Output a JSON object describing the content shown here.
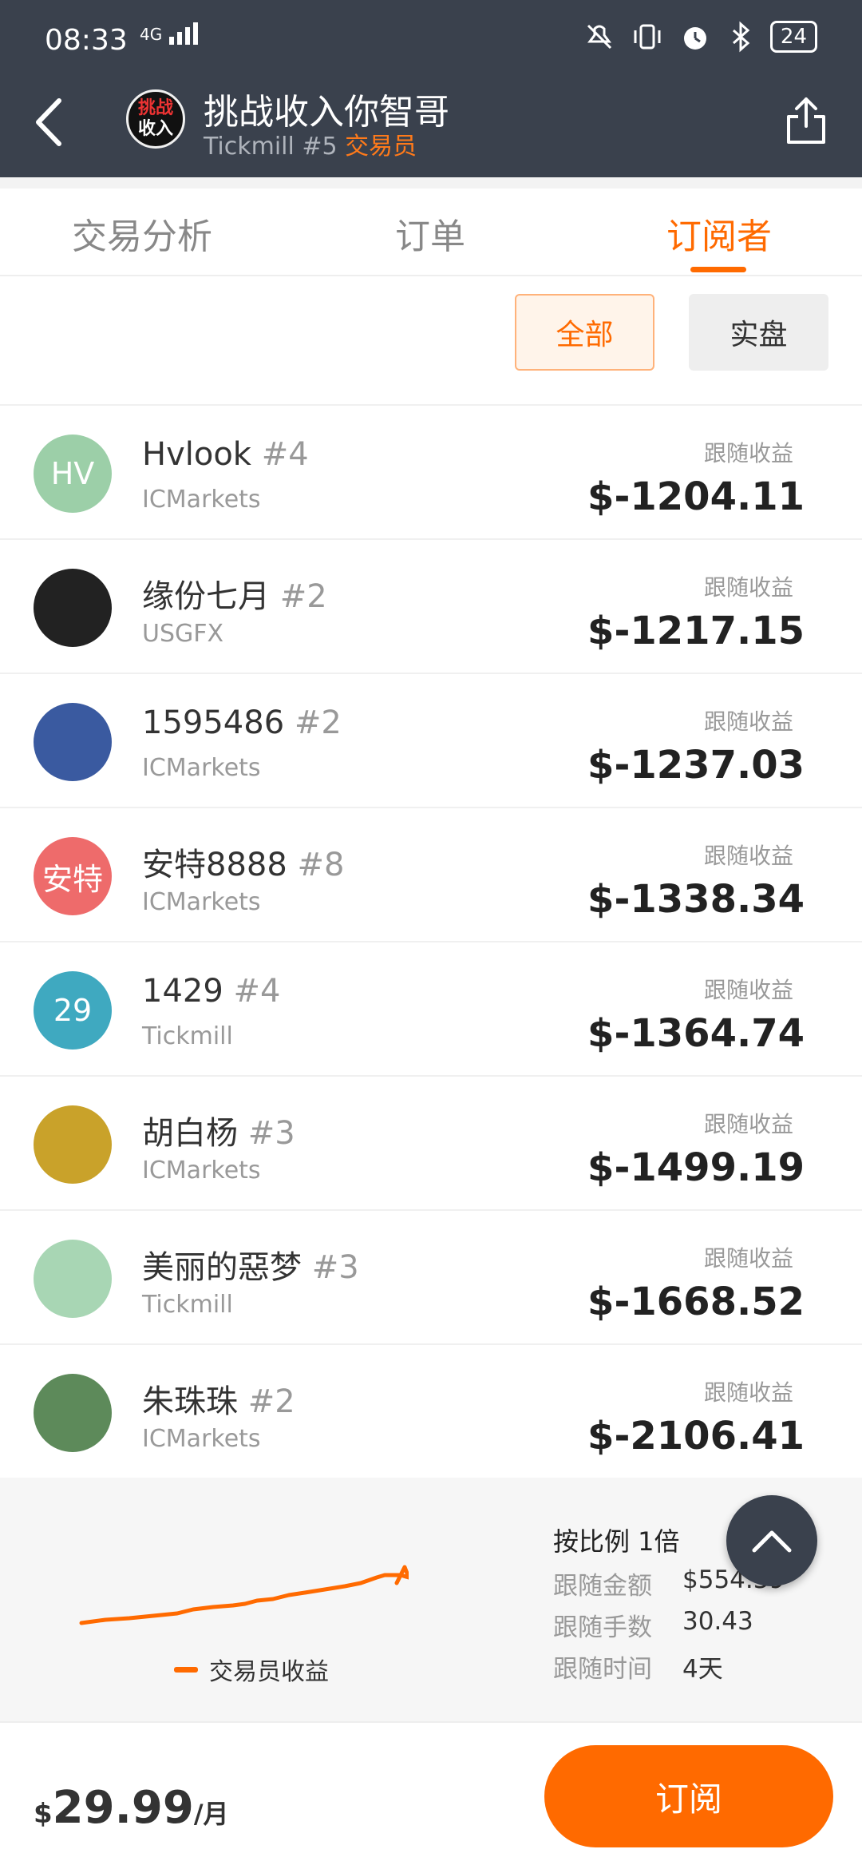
{
  "status_bar": {
    "time": "08:33",
    "network": "4G",
    "battery": "24"
  },
  "header": {
    "avatar_text_line1": "挑战",
    "avatar_text_line2": "收入",
    "title": "挑战收入你智哥",
    "subtitle_prefix": "Tickmill #5 ",
    "subtitle_role": "交易员"
  },
  "tabs": [
    "交易分析",
    "订单",
    "订阅者"
  ],
  "active_tab": "订阅者",
  "filters": {
    "all": "全部",
    "real": "实盘"
  },
  "subscribers": [
    {
      "avatar_text": "HV",
      "avatar_color": "#9ccfa8",
      "name": "Hvlook",
      "rank": "#4",
      "broker": "ICMarkets",
      "label": "跟随收益",
      "amount": "$-1204.11"
    },
    {
      "avatar_text": "",
      "avatar_color": "#222222",
      "name": "缘份七月",
      "rank": "#2",
      "broker": "USGFX",
      "label": "跟随收益",
      "amount": "$-1217.15"
    },
    {
      "avatar_text": "",
      "avatar_color": "#3a5aa0",
      "name": "1595486",
      "rank": "#2",
      "broker": "ICMarkets",
      "label": "跟随收益",
      "amount": "$-1237.03"
    },
    {
      "avatar_text": "安特",
      "avatar_color": "#ee6b6b",
      "name": "安特8888",
      "rank": "#8",
      "broker": "ICMarkets",
      "label": "跟随收益",
      "amount": "$-1338.34"
    },
    {
      "avatar_text": "29",
      "avatar_color": "#3fa9c0",
      "name": "1429",
      "rank": "#4",
      "broker": "Tickmill",
      "label": "跟随收益",
      "amount": "$-1364.74"
    },
    {
      "avatar_text": "",
      "avatar_color": "#c9a22a",
      "name": "胡白杨",
      "rank": "#3",
      "broker": "ICMarkets",
      "label": "跟随收益",
      "amount": "$-1499.19"
    },
    {
      "avatar_text": "",
      "avatar_color": "#a8d6b4",
      "name": "美丽的惡梦",
      "rank": "#3",
      "broker": "Tickmill",
      "label": "跟随收益",
      "amount": "$-1668.52"
    },
    {
      "avatar_text": "",
      "avatar_color": "#5d8a5a",
      "name": "朱珠珠",
      "rank": "#2",
      "broker": "ICMarkets",
      "label": "跟随收益",
      "amount": "$-2106.41"
    }
  ],
  "summary": {
    "legend": "交易员收益",
    "ratio": "按比例 1倍",
    "amount_label": "跟随金额",
    "amount_value": "$554.39",
    "lots_label": "跟随手数",
    "lots_value": "30.43",
    "time_label": "跟随时间",
    "time_value": "4天"
  },
  "footer": {
    "currency": "$",
    "price": "29.99",
    "unit": "/月",
    "subscribe": "订阅"
  },
  "colors": {
    "accent": "#ff6a00",
    "header_bg": "#3a414d"
  }
}
